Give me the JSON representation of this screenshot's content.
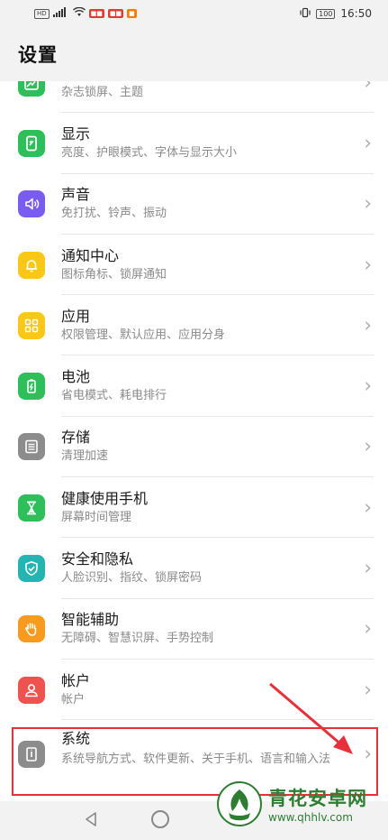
{
  "status_bar": {
    "left_tags": [
      "HD",
      "4G"
    ],
    "battery": "100",
    "time": "16:50"
  },
  "header": {
    "title": "设置"
  },
  "items": [
    {
      "key": "wallpaper",
      "title": "",
      "subtitle": "杂志锁屏、主题",
      "icon": "wallpaper-icon",
      "color": "#2fbf5a"
    },
    {
      "key": "display",
      "title": "显示",
      "subtitle": "亮度、护眼模式、字体与显示大小",
      "icon": "display-icon",
      "color": "#2fbf5a"
    },
    {
      "key": "sound",
      "title": "声音",
      "subtitle": "免打扰、铃声、振动",
      "icon": "sound-icon",
      "color": "#7a5cf0"
    },
    {
      "key": "notification",
      "title": "通知中心",
      "subtitle": "图标角标、锁屏通知",
      "icon": "bell-icon",
      "color": "#f9c817"
    },
    {
      "key": "apps",
      "title": "应用",
      "subtitle": "权限管理、默认应用、应用分身",
      "icon": "apps-grid-icon",
      "color": "#f9c817"
    },
    {
      "key": "battery",
      "title": "电池",
      "subtitle": "省电模式、耗电排行",
      "icon": "battery-icon",
      "color": "#2fbf5a"
    },
    {
      "key": "storage",
      "title": "存储",
      "subtitle": "清理加速",
      "icon": "storage-icon",
      "color": "#8c8c8c"
    },
    {
      "key": "digital-balance",
      "title": "健康使用手机",
      "subtitle": "屏幕时间管理",
      "icon": "hourglass-icon",
      "color": "#2fbf5a"
    },
    {
      "key": "security",
      "title": "安全和隐私",
      "subtitle": "人脸识别、指纹、锁屏密码",
      "icon": "shield-icon",
      "color": "#24b5b3"
    },
    {
      "key": "accessibility",
      "title": "智能辅助",
      "subtitle": "无障碍、智慧识屏、手势控制",
      "icon": "hand-icon",
      "color": "#f79a1e"
    },
    {
      "key": "accounts",
      "title": "帐户",
      "subtitle": "帐户",
      "icon": "account-icon",
      "color": "#ef5350"
    },
    {
      "key": "system",
      "title": "系统",
      "subtitle": "系统导航方式、软件更新、关于手机、语言和输入法",
      "icon": "system-icon",
      "color": "#8c8c8c"
    }
  ],
  "chevron": "›",
  "watermark": {
    "name": "青花安卓网",
    "url": "www.qhhlv.com"
  },
  "highlight_color": "#e8303a"
}
